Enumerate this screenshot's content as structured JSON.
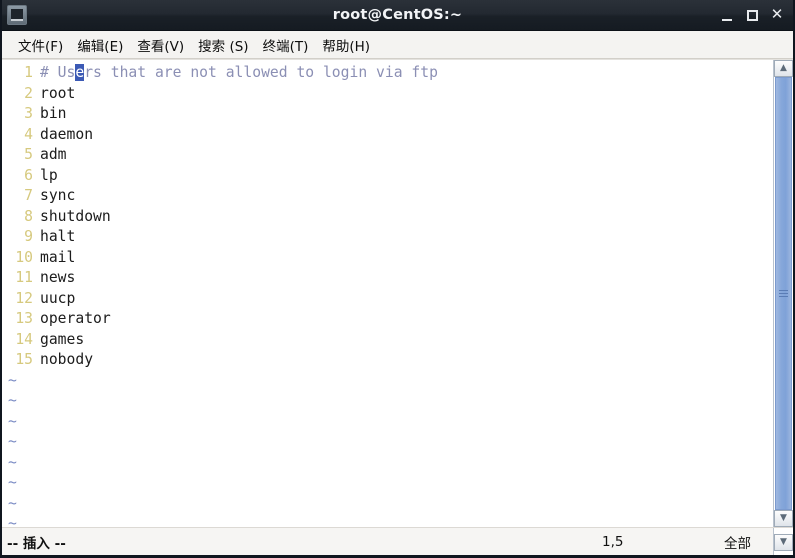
{
  "window": {
    "title": "root@CentOS:~",
    "icon": "terminal-icon",
    "buttons": {
      "minimize": "minimize-icon",
      "maximize": "maximize-icon",
      "close": "✕"
    }
  },
  "menubar": {
    "items": [
      {
        "label": "文件(F)"
      },
      {
        "label": "编辑(E)"
      },
      {
        "label": "查看(V)"
      },
      {
        "label": "搜索 (S)"
      },
      {
        "label": "终端(T)"
      },
      {
        "label": "帮助(H)"
      }
    ]
  },
  "editor": {
    "lines": [
      {
        "num": "1",
        "text": "# Users that are not allowed to login via ftp",
        "comment": true,
        "cursor": {
          "before": "# Us",
          "at": "e",
          "after": "rs that are not allowed to login via ftp"
        }
      },
      {
        "num": "2",
        "text": "root",
        "comment": false
      },
      {
        "num": "3",
        "text": "bin",
        "comment": false
      },
      {
        "num": "4",
        "text": "daemon",
        "comment": false
      },
      {
        "num": "5",
        "text": "adm",
        "comment": false
      },
      {
        "num": "6",
        "text": "lp",
        "comment": false
      },
      {
        "num": "7",
        "text": "sync",
        "comment": false
      },
      {
        "num": "8",
        "text": "shutdown",
        "comment": false
      },
      {
        "num": "9",
        "text": "halt",
        "comment": false
      },
      {
        "num": "10",
        "text": "mail",
        "comment": false
      },
      {
        "num": "11",
        "text": "news",
        "comment": false
      },
      {
        "num": "12",
        "text": "uucp",
        "comment": false
      },
      {
        "num": "13",
        "text": "operator",
        "comment": false
      },
      {
        "num": "14",
        "text": "games",
        "comment": false
      },
      {
        "num": "15",
        "text": "nobody",
        "comment": false
      }
    ],
    "empty_marker": "~",
    "empty_count": 8
  },
  "scrollbar": {
    "up_arrow": "▲",
    "down_arrow": "▼"
  },
  "statusbar": {
    "mode": "-- 插入 --",
    "position": "1,5",
    "scope": "全部",
    "down_arrow": "▼"
  },
  "colors": {
    "titlebar": "#232931",
    "comment_text": "#8b8fb4",
    "line_number": "#d6c97e",
    "tilde": "#7b8cc4",
    "cursor": "#3c5ab5",
    "scrollbar_thumb": "#86a7da",
    "code_text": "#1c1c1c"
  }
}
